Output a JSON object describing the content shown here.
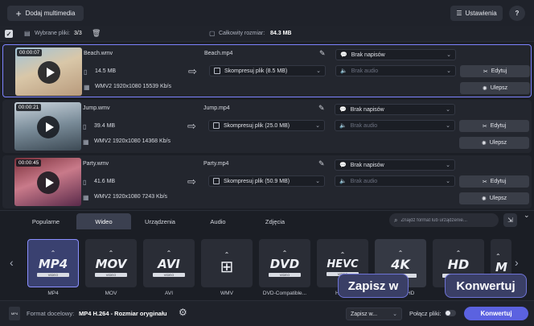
{
  "toolbar": {
    "add_label": "Dodaj multimedia",
    "settings_label": "Ustawienia",
    "help_label": "?"
  },
  "summary": {
    "selected_label": "Wybrane pliki:",
    "selected_value": "3/3",
    "total_label": "Całkowity rozmiar:",
    "total_value": "84.3 MB"
  },
  "rows": [
    {
      "duration": "00:00:07",
      "source_name": "Beach.wmv",
      "size": "14.5 MB",
      "info": "WMV2 1920x1080 15539 Kb/s",
      "output_name": "Beach.mp4",
      "compress": "Skompresuj plik (8.5 MB)",
      "subtitles": "Brak napisów",
      "audio": "Brak audio",
      "edit_label": "Edytuj",
      "enhance_label": "Ulepsz"
    },
    {
      "duration": "00:00:21",
      "source_name": "Jump.wmv",
      "size": "39.4 MB",
      "info": "WMV2 1920x1080 14368 Kb/s",
      "output_name": "Jump.mp4",
      "compress": "Skompresuj plik (25.0 MB)",
      "subtitles": "Brak napisów",
      "audio": "Brak audio",
      "edit_label": "Edytuj",
      "enhance_label": "Ulepsz"
    },
    {
      "duration": "00:00:45",
      "source_name": "Party.wmv",
      "size": "41.6 MB",
      "info": "WMV2 1920x1080 7243 Kb/s",
      "output_name": "Party.mp4",
      "compress": "Skompresuj plik (50.9 MB)",
      "subtitles": "Brak napisów",
      "audio": "Brak audio",
      "edit_label": "Edytuj",
      "enhance_label": "Ulepsz"
    }
  ],
  "tabs": [
    "Popularne",
    "Wideo",
    "Urządzenia",
    "Audio",
    "Zdjęcia"
  ],
  "search_placeholder": "Znajdź format lub urządzenie...",
  "formats": [
    {
      "logo": "MP4",
      "sub": "VIDEO",
      "name": "MP4"
    },
    {
      "logo": "MOV",
      "sub": "VIDEO",
      "name": "MOV"
    },
    {
      "logo": "AVI",
      "sub": "VIDEO",
      "name": "AVI"
    },
    {
      "logo": "",
      "sub": "",
      "name": "WMV"
    },
    {
      "logo": "DVD",
      "sub": "VIDEO",
      "name": "DVD-Compatible..."
    },
    {
      "logo": "HEVC",
      "sub": "VIDEO",
      "name": "HEVC"
    },
    {
      "logo": "4K",
      "sub": "VIDEO",
      "name": "4K Ultra HD"
    },
    {
      "logo": "HD",
      "sub": "VIDEO",
      "name": ""
    },
    {
      "logo": "M",
      "sub": "",
      "name": ""
    }
  ],
  "bottom": {
    "target_label": "Format docelowy:",
    "target_value": "MP4 H.264 - Rozmiar oryginału",
    "save_label": "Zapisz w...",
    "merge_label": "Połącz pliki:",
    "convert_label": "Konwertuj"
  },
  "tooltips": {
    "save": "Zapisz w",
    "convert": "Konwertuj"
  },
  "colors": {
    "accent": "#7d83ff",
    "convert_button": "#5b62e0"
  }
}
